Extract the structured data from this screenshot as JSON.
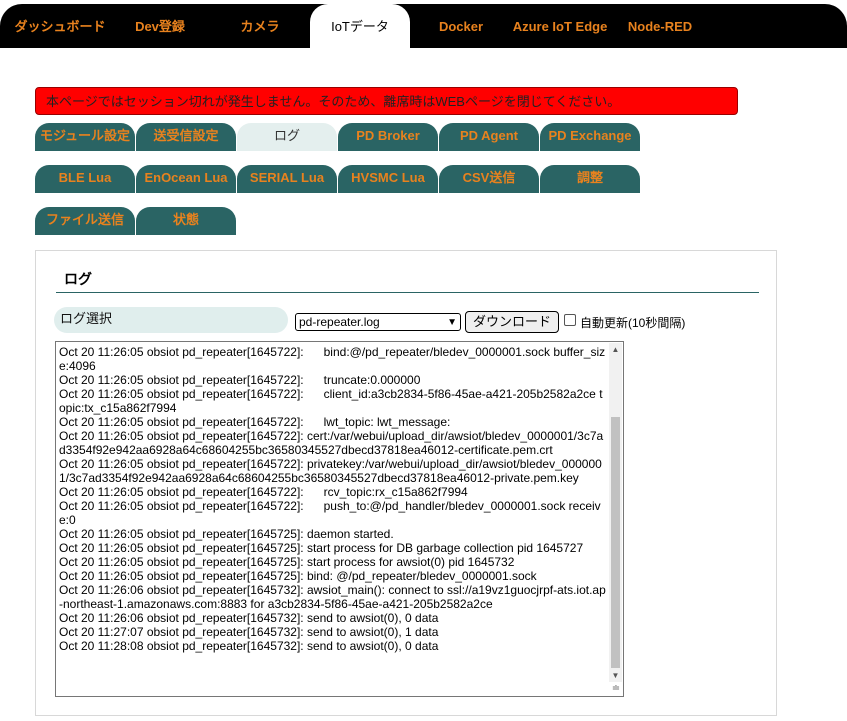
{
  "nav": {
    "tabs": [
      "ダッシュボード",
      "Dev登録",
      "カメラ",
      "IoTデータ",
      "Docker",
      "Azure IoT Edge",
      "Node-RED"
    ],
    "active": "IoTデータ"
  },
  "alert": {
    "message": "本ページではセッション切れが発生しません。そのため、離席時はWEBページを閉じてください。"
  },
  "subtabs": {
    "row1": [
      "モジュール設定",
      "送受信設定",
      "ログ",
      "PD Broker",
      "PD Agent",
      "PD Exchange"
    ],
    "row2": [
      "BLE Lua",
      "EnOcean Lua",
      "SERIAL Lua",
      "HVSMC Lua",
      "CSV送信",
      "調整"
    ],
    "row3": [
      "ファイル送信",
      "状態"
    ],
    "active": "ログ"
  },
  "panel": {
    "title": "ログ",
    "select_label": "ログ選択",
    "selected_file": "pd-repeater.log",
    "download_button": "ダウンロード",
    "auto_update_label": "自動更新(10秒間隔)",
    "auto_update_checked": false
  },
  "log": {
    "text": "Oct 20 11:26:05 obsiot pd_repeater[1645722]:      bind:@/pd_repeater/bledev_0000001.sock buffer_size:4096\nOct 20 11:26:05 obsiot pd_repeater[1645722]:      truncate:0.000000\nOct 20 11:26:05 obsiot pd_repeater[1645722]:      client_id:a3cb2834-5f86-45ae-a421-205b2582a2ce topic:tx_c15a862f7994\nOct 20 11:26:05 obsiot pd_repeater[1645722]:      lwt_topic: lwt_message:\nOct 20 11:26:05 obsiot pd_repeater[1645722]: cert:/var/webui/upload_dir/awsiot/bledev_0000001/3c7ad3354f92e942aa6928a64c68604255bc36580345527dbecd37818ea46012-certificate.pem.crt\nOct 20 11:26:05 obsiot pd_repeater[1645722]: privatekey:/var/webui/upload_dir/awsiot/bledev_0000001/3c7ad3354f92e942aa6928a64c68604255bc36580345527dbecd37818ea46012-private.pem.key\nOct 20 11:26:05 obsiot pd_repeater[1645722]:      rcv_topic:rx_c15a862f7994\nOct 20 11:26:05 obsiot pd_repeater[1645722]:      push_to:@/pd_handler/bledev_0000001.sock receive:0\nOct 20 11:26:05 obsiot pd_repeater[1645725]: daemon started.\nOct 20 11:26:05 obsiot pd_repeater[1645725]: start process for DB garbage collection pid 1645727\nOct 20 11:26:05 obsiot pd_repeater[1645725]: start process for awsiot(0) pid 1645732\nOct 20 11:26:05 obsiot pd_repeater[1645725]: bind: @/pd_repeater/bledev_0000001.sock\nOct 20 11:26:06 obsiot pd_repeater[1645732]: awsiot_main(): connect to ssl://a19vz1guocjrpf-ats.iot.ap-northeast-1.amazonaws.com:8883 for a3cb2834-5f86-45ae-a421-205b2582a2ce\nOct 20 11:26:06 obsiot pd_repeater[1645732]: send to awsiot(0), 0 data\nOct 20 11:27:07 obsiot pd_repeater[1645732]: send to awsiot(0), 1 data\nOct 20 11:28:08 obsiot pd_repeater[1645732]: send to awsiot(0), 0 data"
  },
  "colors": {
    "nav_bg": "#000000",
    "nav_text": "#e8821e",
    "tab_bg": "#2a6464",
    "tab_active_bg": "#e4efee",
    "alert_bg": "#ff0000"
  }
}
